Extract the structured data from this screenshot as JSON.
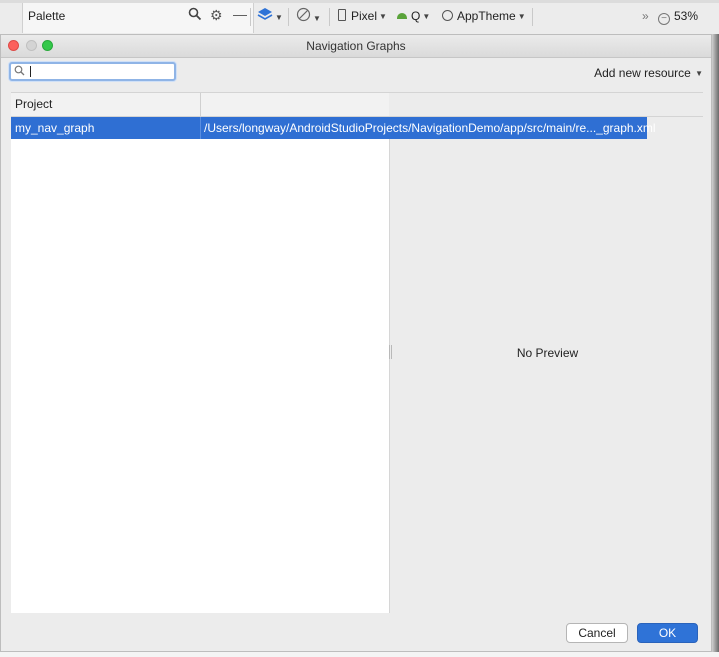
{
  "ide": {
    "palette_label": "Palette",
    "device": "Pixel",
    "api": "Q",
    "theme": "AppTheme",
    "zoom": "53%",
    "more": "»"
  },
  "dialog": {
    "title": "Navigation Graphs",
    "search": {
      "value": "",
      "placeholder": ""
    },
    "add_resource_label": "Add new resource",
    "table": {
      "headers": [
        "Project",
        ""
      ],
      "rows": [
        {
          "name": "my_nav_graph",
          "path": "/Users/longway/AndroidStudioProjects/NavigationDemo/app/src/main/re..._graph.xml",
          "selected": true
        }
      ]
    },
    "preview_text": "No Preview",
    "cancel_label": "Cancel",
    "ok_label": "OK"
  },
  "colors": {
    "selection": "#2f6fd3",
    "ok_button": "#2f73d7",
    "close_light": "#fc605c",
    "max_light": "#34c84a"
  },
  "icons": {
    "search": "search-icon",
    "settings": "gear-icon",
    "layers": "layers-icon",
    "orientation": "rotate-icon",
    "device": "phone-icon",
    "android": "android-icon",
    "theme": "theme-icon",
    "zoom_out": "zoom-out-icon"
  }
}
